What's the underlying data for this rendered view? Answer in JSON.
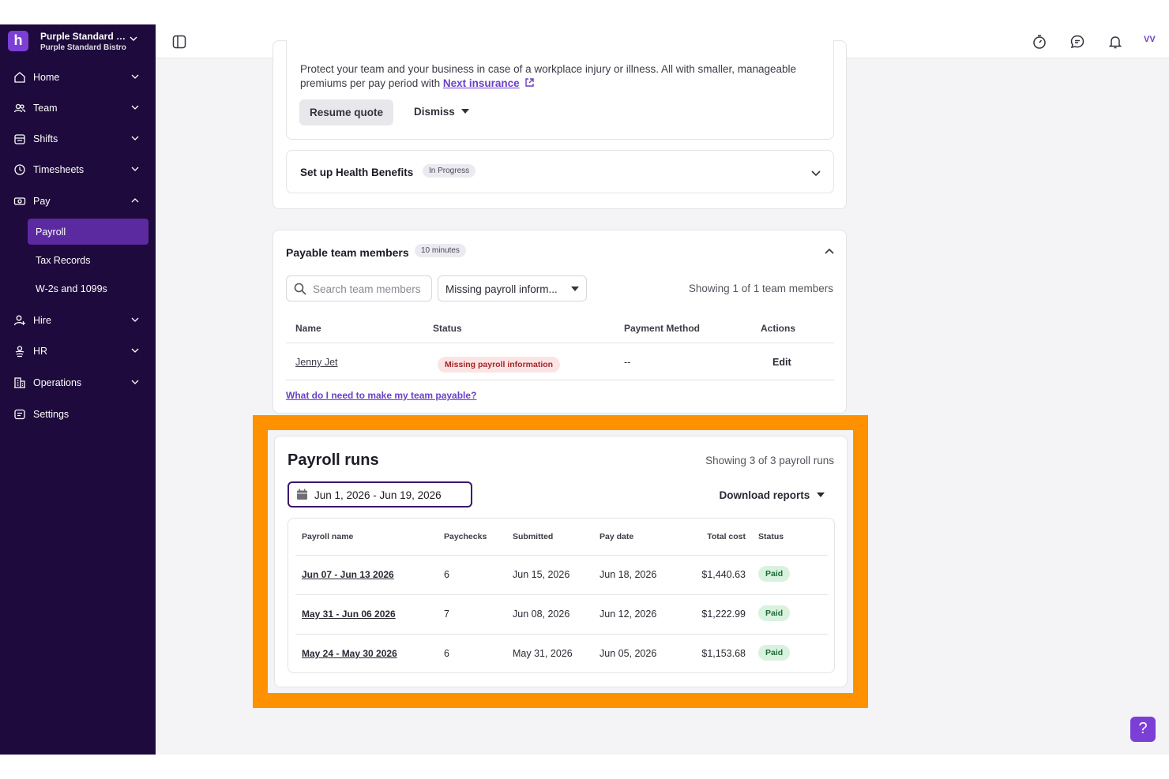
{
  "org": {
    "logo_letter": "h",
    "name": "Purple Standard C...",
    "location": "Purple Standard Bistro"
  },
  "nav": {
    "home": "Home",
    "team": "Team",
    "shifts": "Shifts",
    "timesheets": "Timesheets",
    "pay": "Pay",
    "payroll": "Payroll",
    "tax_records": "Tax Records",
    "w2s": "W-2s and 1099s",
    "hire": "Hire",
    "hr": "HR",
    "operations": "Operations",
    "settings": "Settings"
  },
  "topbar": {
    "avatar_initials": "VV"
  },
  "insurance": {
    "text1": "Protect your team and your business in case of a workplace injury or illness. All with smaller, manageable",
    "text2": "premiums per pay period with",
    "link": "Next insurance",
    "resume_label": "Resume quote",
    "dismiss_label": "Dismiss"
  },
  "health": {
    "title": "Set up Health Benefits",
    "status": "In Progress"
  },
  "payable": {
    "title": "Payable team members",
    "duration": "10 minutes",
    "search_placeholder": "Search team members",
    "filter_value": "Missing payroll inform...",
    "showing": "Showing 1 of 1 team members",
    "columns": {
      "name": "Name",
      "status": "Status",
      "payment": "Payment Method",
      "actions": "Actions"
    },
    "row": {
      "name": "Jenny Jet",
      "status": "Missing payroll information",
      "payment": "--",
      "action": "Edit"
    },
    "help_link": "What do I need to make my team payable?"
  },
  "payroll_runs": {
    "title": "Payroll runs",
    "showing": "Showing 3 of 3 payroll runs",
    "date_range": "Jun 1, 2026 - Jun 19, 2026",
    "download_label": "Download reports",
    "columns": {
      "name": "Payroll name",
      "paychecks": "Paychecks",
      "submitted": "Submitted",
      "pay_date": "Pay date",
      "total": "Total cost",
      "status": "Status"
    },
    "rows": [
      {
        "name": "Jun 07 - Jun 13 2026",
        "paychecks": "6",
        "submitted": "Jun 15, 2026",
        "pay_date": "Jun 18, 2026",
        "total": "$1,440.63",
        "status": "Paid"
      },
      {
        "name": "May 31 - Jun 06 2026",
        "paychecks": "7",
        "submitted": "Jun 08, 2026",
        "pay_date": "Jun 12, 2026",
        "total": "$1,222.99",
        "status": "Paid"
      },
      {
        "name": "May 24 - May 30 2026",
        "paychecks": "6",
        "submitted": "May 31, 2026",
        "pay_date": "Jun 05, 2026",
        "total": "$1,153.68",
        "status": "Paid"
      }
    ]
  },
  "help_button": "?",
  "colors": {
    "sidebar": "#1e0a3c",
    "accent": "#6b3fc6",
    "highlight": "#ff9100",
    "paid_bg": "#d9f2df",
    "missing_bg": "#fde4e4"
  }
}
